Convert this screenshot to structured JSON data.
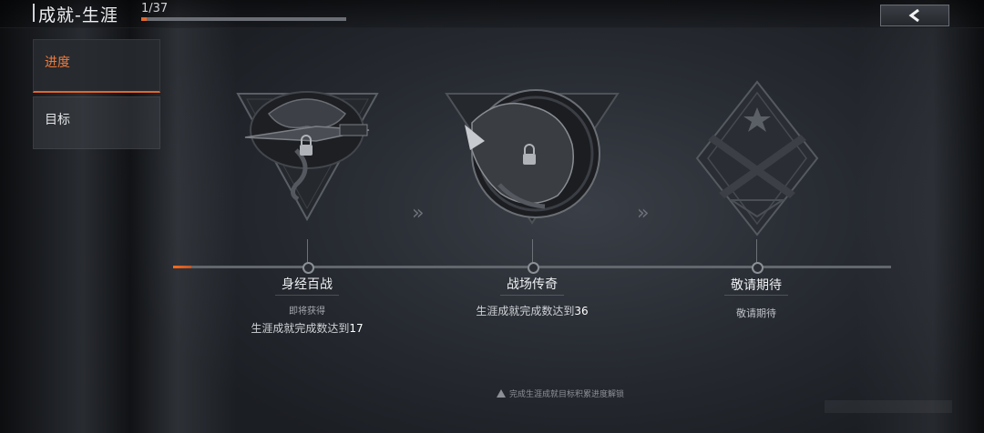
{
  "header": {
    "title": "成就-生涯",
    "progress_text": "1/37",
    "progress_fraction": 0.027
  },
  "sidebar": {
    "tabs": [
      {
        "label": "进度",
        "active": true
      },
      {
        "label": "目标",
        "active": false
      }
    ]
  },
  "achievements": [
    {
      "name": "身经百战",
      "status": "即将获得",
      "requirement_prefix": "生涯成就完成数达到",
      "requirement_value": "17",
      "locked": true,
      "icon": "cobra-knife-badge-icon"
    },
    {
      "name": "战场传奇",
      "status": "",
      "requirement_prefix": "生涯成就完成数达到",
      "requirement_value": "36",
      "locked": true,
      "icon": "roaring-bear-badge-icon"
    },
    {
      "name": "敬请期待",
      "status": "",
      "requirement_prefix": "敬请期待",
      "requirement_value": "",
      "locked": false,
      "icon": "crossed-rifles-badge-icon"
    }
  ],
  "timeline": {
    "progress_fraction": 0.026
  },
  "footer": {
    "hint": "完成生涯成就目标积累进度解锁"
  },
  "colors": {
    "accent": "#e0672e",
    "text": "#eef0f2"
  }
}
